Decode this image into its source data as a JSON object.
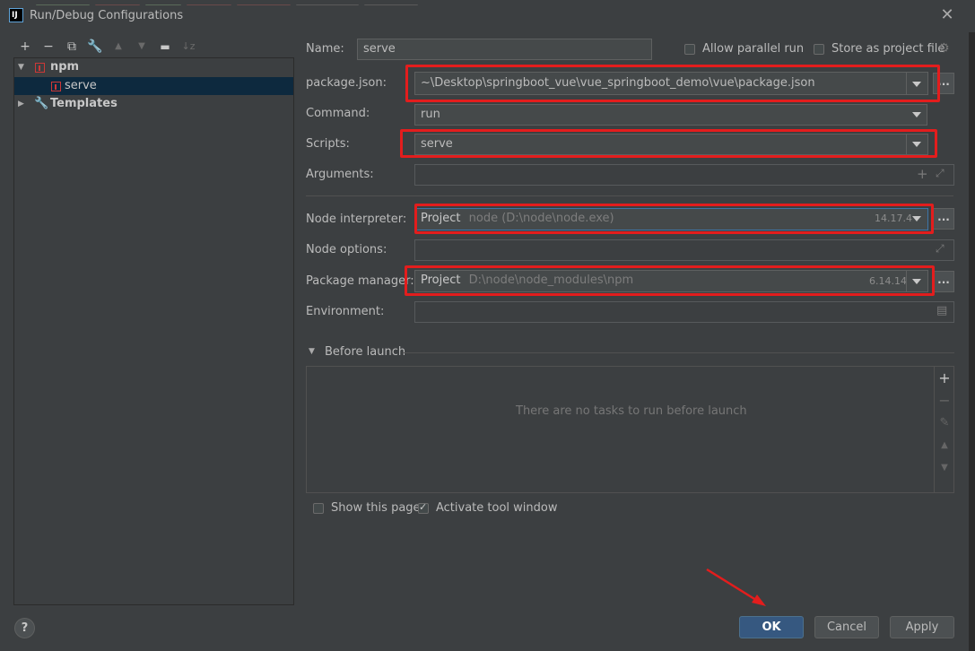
{
  "window": {
    "title": "Run/Debug Configurations"
  },
  "tree": {
    "items": [
      {
        "label": "npm"
      },
      {
        "label": "serve"
      },
      {
        "label": "Templates"
      }
    ]
  },
  "form": {
    "name_label": "Name:",
    "name_value": "serve",
    "allow_parallel_label": "Allow parallel run",
    "store_as_project_label": "Store as project file",
    "package_json_label": "package.json:",
    "package_json_value": "~\\Desktop\\springboot_vue\\vue_springboot_demo\\vue\\package.json",
    "command_label": "Command:",
    "command_value": "run",
    "scripts_label": "Scripts:",
    "scripts_value": "serve",
    "arguments_label": "Arguments:",
    "node_interpreter_label": "Node interpreter:",
    "node_interpreter_kind": "Project",
    "node_interpreter_path": "node (D:\\node\\node.exe)",
    "node_interpreter_version": "14.17.4",
    "node_options_label": "Node options:",
    "package_manager_label": "Package manager:",
    "package_manager_kind": "Project",
    "package_manager_path": "D:\\node\\node_modules\\npm",
    "package_manager_version": "6.14.14",
    "environment_label": "Environment:"
  },
  "before_launch": {
    "title": "Before launch",
    "empty_text": "There are no tasks to run before launch"
  },
  "options": {
    "show_this_page_label": "Show this page",
    "activate_tool_window_label": "Activate tool window"
  },
  "buttons": {
    "ok": "OK",
    "cancel": "Cancel",
    "apply": "Apply",
    "help": "?"
  },
  "colors": {
    "background": "#3c3f41",
    "highlight": "#e31d1d",
    "primary_button": "#365880",
    "selection": "#0d293e"
  }
}
